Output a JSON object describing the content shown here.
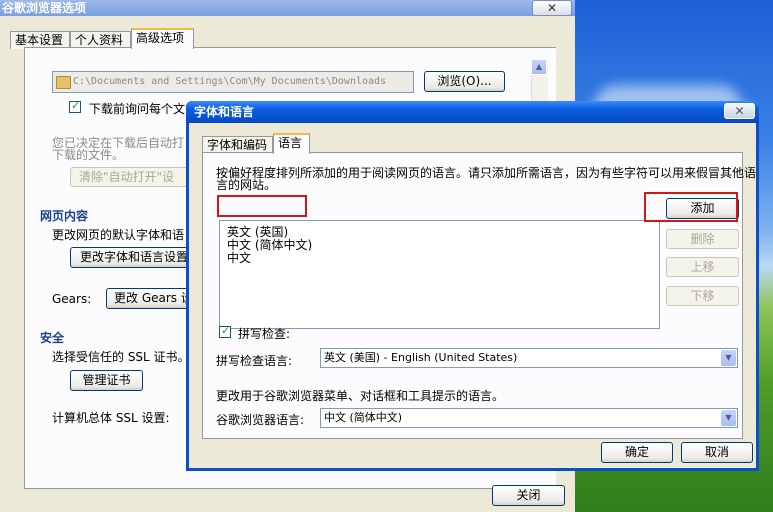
{
  "outer_window": {
    "title": "谷歌浏览器选项",
    "close": "✕",
    "tabs": [
      "基本设置",
      "个人资料",
      "高级选项"
    ],
    "download_path": "C:\\Documents and Settings\\Com\\My Documents\\Downloads",
    "browse_button": "浏览(O)...",
    "ask_checkbox_label": "下载前询问每个文",
    "auto_open_text_line1": "您已决定在下载后自动打",
    "auto_open_text_line2": "下载的文件。",
    "clear_auto_open_button": "清除\"自动打开\"设",
    "web_content_heading": "网页内容",
    "web_content_desc": "更改网页的默认字体和语",
    "change_fonts_button": "更改字体和语言设置",
    "gears_label": "Gears:",
    "gears_button": "更改 Gears 设",
    "security_heading": "安全",
    "ssl_desc": "选择受信任的 SSL 证书。",
    "manage_certs_button": "管理证书",
    "ssl_settings_label": "计算机总体 SSL 设置:",
    "close_button": "关闭"
  },
  "dialog": {
    "title": "字体和语言",
    "close": "✕",
    "tabs": [
      "字体和编码",
      "语言"
    ],
    "description": "按偏好程度排列所添加的用于阅读网页的语言。请只添加所需语言，因为有些字符可以用来假冒其他语言的网站。",
    "languages": [
      "英文 (英国)",
      "中文 (简体中文)",
      "中文"
    ],
    "buttons": {
      "add": "添加",
      "remove": "删除",
      "move_up": "上移",
      "move_down": "下移",
      "ok": "确定",
      "cancel": "取消"
    },
    "spellcheck_label": "拼写检查:",
    "spellcheck_language_label": "拼写检查语言:",
    "spellcheck_language_value": "英文 (美国) - English (United States)",
    "ui_language_desc": "更改用于谷歌浏览器菜单、对话框和工具提示的语言。",
    "ui_language_label": "谷歌浏览器语言:",
    "ui_language_value": "中文 (简体中文)"
  },
  "colors": {
    "dialog_title_blue": "#0b5fe0",
    "highlight_red": "#d01818",
    "section_heading": "#1c3f94"
  }
}
